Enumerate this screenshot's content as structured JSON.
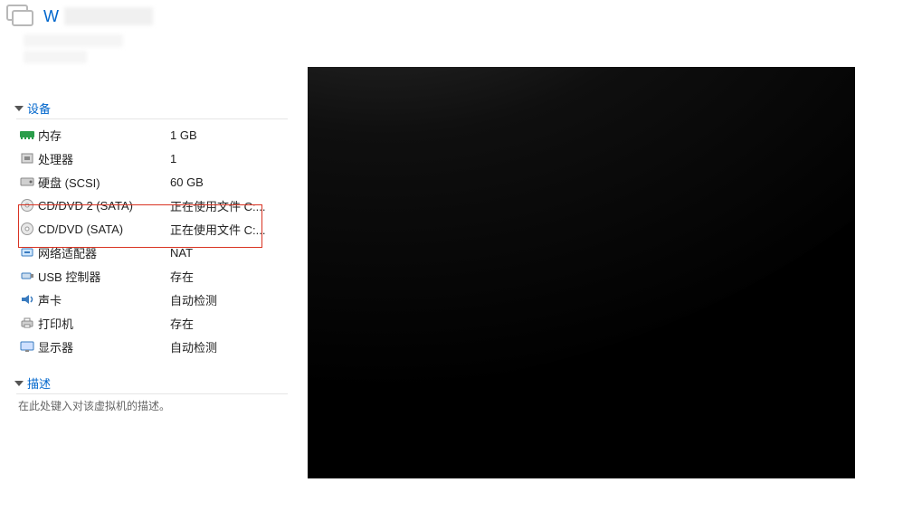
{
  "title": "W",
  "sections": {
    "devices": {
      "header": "设备",
      "items": [
        {
          "icon": "memory-icon",
          "label": "内存",
          "value": "1 GB"
        },
        {
          "icon": "cpu-icon",
          "label": "处理器",
          "value": "1"
        },
        {
          "icon": "harddisk-icon",
          "label": "硬盘 (SCSI)",
          "value": "60 GB"
        },
        {
          "icon": "disc-icon",
          "label": "CD/DVD 2 (SATA)",
          "value": "正在使用文件 C:..."
        },
        {
          "icon": "disc-icon",
          "label": "CD/DVD (SATA)",
          "value": "正在使用文件 C:..."
        },
        {
          "icon": "network-icon",
          "label": "网络适配器",
          "value": "NAT"
        },
        {
          "icon": "usb-icon",
          "label": "USB 控制器",
          "value": "存在"
        },
        {
          "icon": "sound-icon",
          "label": "声卡",
          "value": "自动检测"
        },
        {
          "icon": "printer-icon",
          "label": "打印机",
          "value": "存在"
        },
        {
          "icon": "display-icon",
          "label": "显示器",
          "value": "自动检测"
        }
      ]
    },
    "description": {
      "header": "描述",
      "placeholder": "在此处键入对该虚拟机的描述。"
    }
  },
  "highlighted_rows": [
    3,
    4
  ]
}
